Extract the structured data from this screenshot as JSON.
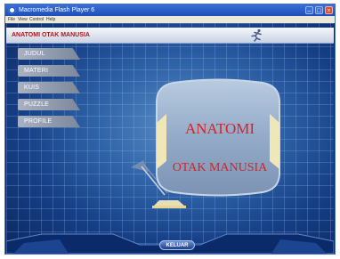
{
  "window": {
    "title": "Macromedia Flash Player 6",
    "menu": [
      "File",
      "View",
      "Control",
      "Help"
    ]
  },
  "header": {
    "title": "ANATOMI OTAK MANUSIA"
  },
  "side_menu": [
    {
      "label": "JUDUL"
    },
    {
      "label": "MATERI"
    },
    {
      "label": "KUIS"
    },
    {
      "label": "PUZZLE"
    },
    {
      "label": "PROFILE"
    }
  ],
  "screen": {
    "line1": "ANATOMI",
    "line2": "OTAK MANUSIA"
  },
  "footer": {
    "exit_label": "KELUAR"
  },
  "colors": {
    "title_red": "#b01818",
    "screen_text_red": "#d42424"
  }
}
